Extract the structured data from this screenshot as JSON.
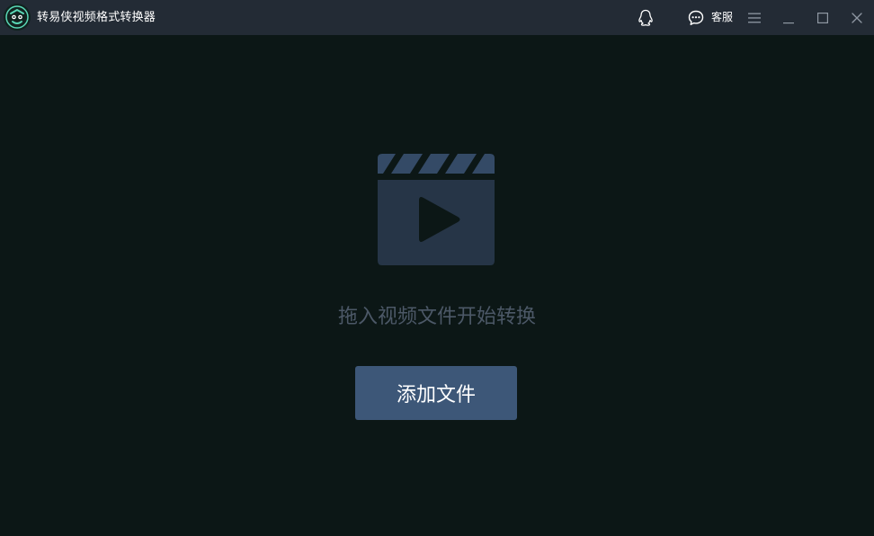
{
  "titlebar": {
    "app_title": "转易侠视频格式转换器",
    "icons": {
      "logo": "app-logo-icon",
      "qq": "qq-penguin-icon",
      "service": "chat-bubble-icon",
      "menu": "hamburger-menu-icon",
      "minimize": "minimize-icon",
      "maximize": "maximize-icon",
      "close": "close-icon"
    },
    "service_label": "客服"
  },
  "main": {
    "drop_icon": "video-clapper-play-icon",
    "hint": "拖入视频文件开始转换",
    "add_button_label": "添加文件"
  },
  "colors": {
    "titlebar_bg": "#232b35",
    "main_bg": "#0c1716",
    "icon_fill": "#263547",
    "icon_top": "#344a66",
    "button_bg": "#3d5778",
    "hint_text": "#4c5867",
    "logo_accent": "#59d7b5"
  }
}
